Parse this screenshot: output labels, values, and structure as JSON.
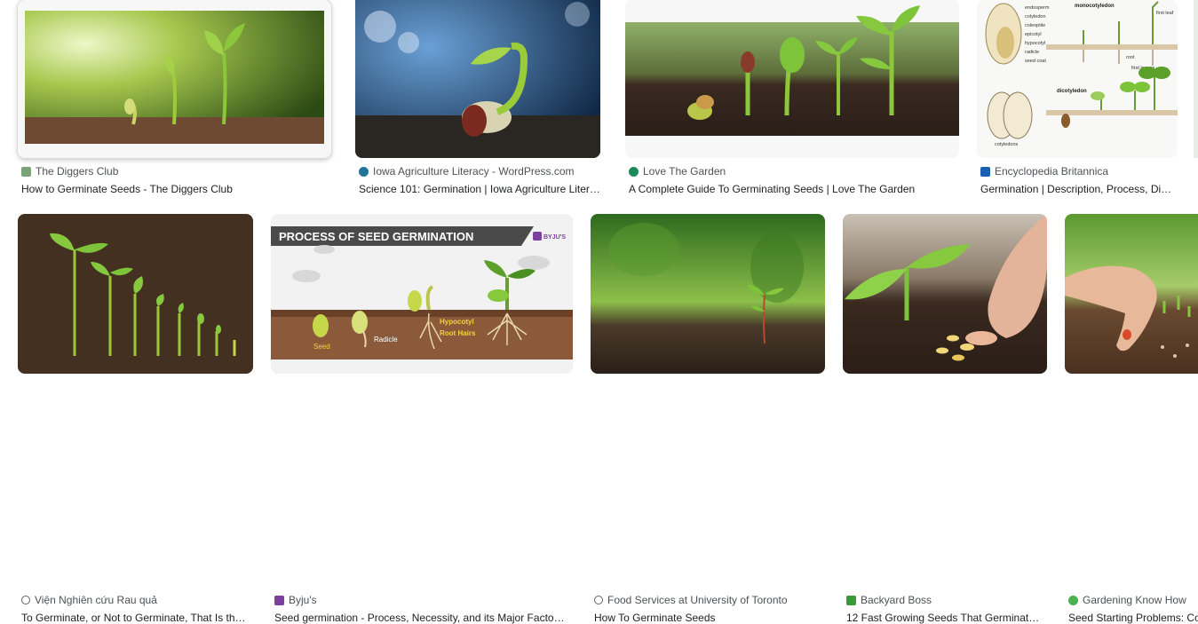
{
  "results": [
    {
      "source": "The Diggers Club",
      "title": "How to Germinate Seeds - The Diggers Club",
      "favicon_color": "#7aa37a"
    },
    {
      "source": "Iowa Agriculture Literacy - WordPress.com",
      "title": "Science 101: Germination | Iowa Agriculture Liter…",
      "favicon_color": "#21759b"
    },
    {
      "source": "Love The Garden",
      "title": "A Complete Guide To Germinating Seeds | Love The Garden",
      "favicon_color": "#1e8a5b"
    },
    {
      "source": "Encyclopedia Britannica",
      "title": "Germination | Description, Process, Di…",
      "favicon_color": "#1a5fb4"
    },
    {
      "source": "Viện Nghiên cứu Rau quả",
      "title": "To Germinate, or Not to Germinate, That Is th…",
      "favicon_color": "#5f6368"
    },
    {
      "source": "Byju's",
      "title": "Seed germination - Process, Necessity, and its Major Facto…",
      "favicon_color": "#7b3fa0"
    },
    {
      "source": "Food Services at University of Toronto",
      "title": "How To Germinate Seeds",
      "favicon_color": "#5f6368"
    },
    {
      "source": "Backyard Boss",
      "title": "12 Fast Growing Seeds That Germinat…",
      "favicon_color": "#3a9a3a"
    },
    {
      "source": "Gardening Know How",
      "title": "Seed Starting Problems: Co",
      "favicon_color": "#4caf50"
    }
  ],
  "diagram_text": {
    "banner": "PROCESS OF SEED GERMINATION",
    "brand": "BYJU'S",
    "seed": "Seed",
    "radicle": "Radicle",
    "hypocotyl": "Hypocotyl",
    "root_hairs": "Root Hairs"
  },
  "britannica_labels": {
    "endosperm": "endosperm",
    "cotyledon": "cotyledon",
    "coleoptile": "coleoptile",
    "epicotyl": "epicotyl",
    "hypocotyl": "hypocotyl",
    "radicle": "radicle",
    "seed_coat": "seed coat",
    "monocotyledon": "monocotyledon",
    "dicotyledon": "dicotyledon",
    "first_leaf": "first leaf",
    "first_leaves": "first leaves",
    "root": "root",
    "cotyledons": "cotyledons"
  }
}
